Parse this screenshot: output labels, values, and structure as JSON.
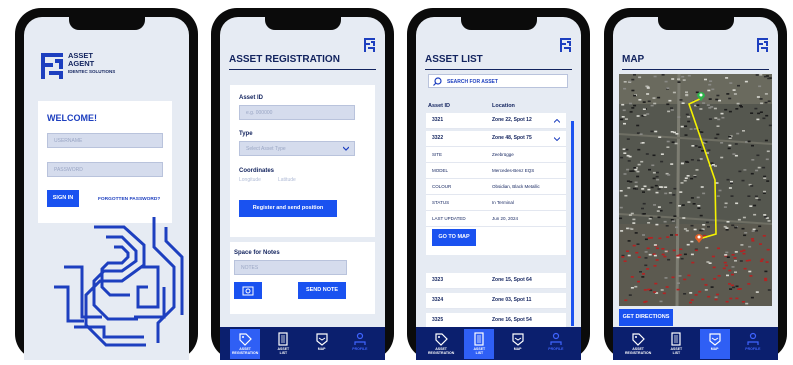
{
  "login": {
    "brand_line1": "ASSET",
    "brand_line2": "AGENT",
    "brand_line3": "IDENTEC SOLUTIONS",
    "welcome": "WELCOME!",
    "username_placeholder": "USERNAME",
    "password_placeholder": "PASSWORD",
    "sign_in": "SIGN IN",
    "forgot": "FORGOTTEN PASSWORD?"
  },
  "registration": {
    "title": "ASSET REGISTRATION",
    "asset_id_label": "Asset ID",
    "asset_id_placeholder": "e.g. 000000",
    "type_label": "Type",
    "type_placeholder": "Select Asset Type",
    "coords_label": "Coordinates",
    "longitude": "Longitude",
    "latitude": "Latitude",
    "register_button": "Register and send position",
    "notes_label": "Space for Notes",
    "notes_placeholder": "NOTES",
    "send_note": "SEND NOTE"
  },
  "asset_list": {
    "title": "ASSET LIST",
    "search_placeholder": "SEARCH FOR ASSET",
    "col_id": "Asset ID",
    "col_location": "Location",
    "rows_top": [
      {
        "id": "3321",
        "location": "Zone 22, Spot 12"
      },
      {
        "id": "3322",
        "location": "Zone 48, Spot 75"
      }
    ],
    "details": [
      {
        "k": "SITE",
        "v": "Zeebrügge"
      },
      {
        "k": "MODEL",
        "v": "Mercedes-Benz EQS"
      },
      {
        "k": "COLOUR",
        "v": "Obsidian, Black Metallic"
      },
      {
        "k": "STATUS",
        "v": "In Terminal"
      },
      {
        "k": "LAST UPDATED",
        "v": "Jun 20, 2024"
      }
    ],
    "go_to_map": "GO TO MAP",
    "rows_bottom": [
      {
        "id": "3323",
        "location": "Zone 15, Spot 64"
      },
      {
        "id": "3324",
        "location": "Zone 03, Spot 11"
      },
      {
        "id": "3325",
        "location": "Zone 16, Spot 54"
      }
    ]
  },
  "map": {
    "title": "MAP",
    "get_directions": "GET DIRECTIONS"
  },
  "nav": {
    "registration_l1": "ASSET",
    "registration_l2": "REGISTRATION",
    "list_l1": "ASSET",
    "list_l2": "LIST",
    "map": "MAP",
    "profile": "PROFILE"
  },
  "colors": {
    "primary": "#1a52f0",
    "navy": "#0b1f6e",
    "background": "#e6ebf3"
  }
}
